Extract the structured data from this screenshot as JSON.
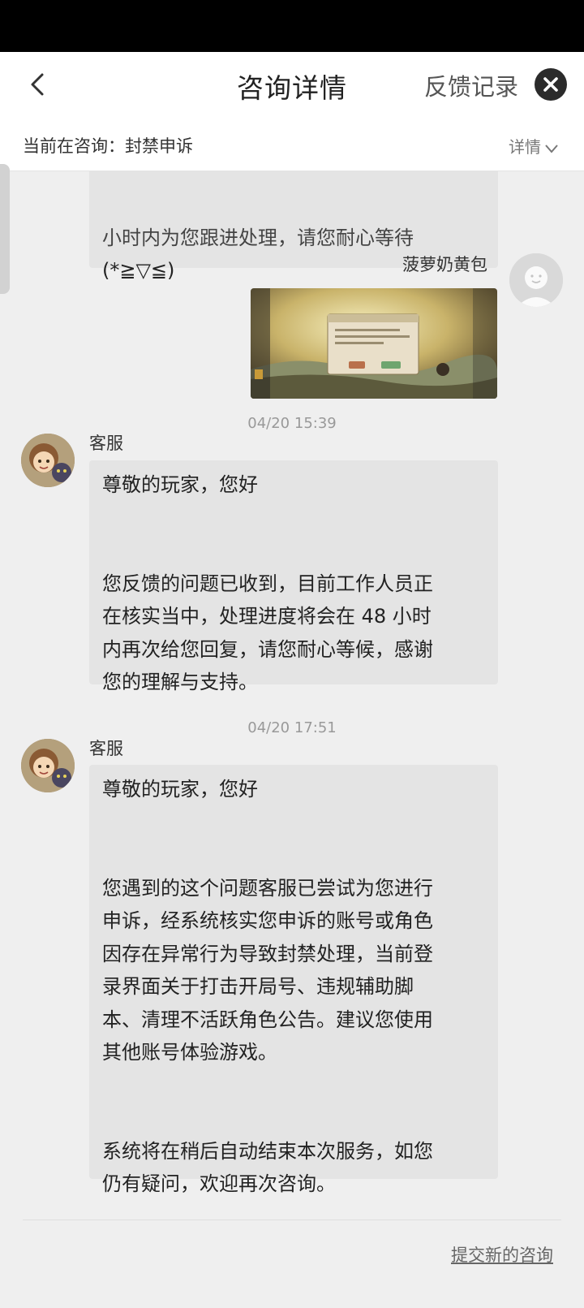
{
  "header": {
    "title": "咨询详情",
    "feedback_label": "反馈记录"
  },
  "topic": {
    "label": "当前在咨询：封禁申诉",
    "detail_label": "详情"
  },
  "messages": {
    "cut_text_line1": "小时内为您跟进处理，请您耐心等待",
    "cut_text_line2": "(*≧▽≦)",
    "user_name": "菠萝奶黄包",
    "msg1_time": "04/20 15:39",
    "msg1_sender": "客服",
    "msg1_text": "尊敬的玩家，您好\n\n\n您反馈的问题已收到，目前工作人员正\n在核实当中，处理进度将会在 48 小时\n内再次给您回复，请您耐心等候，感谢\n您的理解与支持。",
    "msg2_time": "04/20 17:51",
    "msg2_sender": "客服",
    "msg2_text": "尊敬的玩家，您好\n\n\n您遇到的这个问题客服已尝试为您进行\n申诉，经系统核实您申诉的账号或角色\n因存在异常行为导致封禁处理，当前登\n录界面关于打击开局号、违规辅助脚\n本、清理不活跃角色公告。建议您使用\n其他账号体验游戏。\n\n\n系统将在稍后自动结束本次服务，如您\n仍有疑问，欢迎再次咨询。"
  },
  "footer": {
    "new_consult_label": "提交新的咨询"
  },
  "icons": {
    "back": "chevron-left-icon",
    "close": "close-icon",
    "detail": "chevron-down-icon"
  },
  "colors": {
    "header_bg": "#ffffff",
    "chat_bg": "#efefef",
    "bubble_bg": "#e4e4e4",
    "close_bg": "#2b2b2b"
  }
}
